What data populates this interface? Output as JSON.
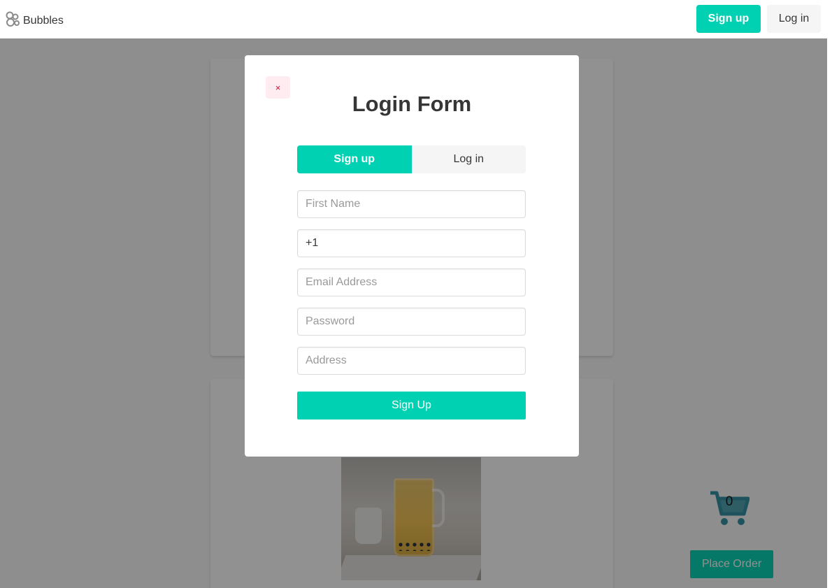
{
  "navbar": {
    "brand": "Bubbles",
    "brand_icon": "bubbles-logo-icon",
    "signup_label": "Sign up",
    "login_label": "Log in"
  },
  "page": {
    "cart_count": "0",
    "cart_icon": "shopping-cart-icon",
    "place_order_label": "Place Order"
  },
  "modal": {
    "close_label": "×",
    "title": "Login Form",
    "tabs": {
      "signup": "Sign up",
      "login": "Log in",
      "active": "signup"
    },
    "fields": {
      "first_name_placeholder": "First Name",
      "phone_value": "+1",
      "email_placeholder": "Email Address",
      "password_placeholder": "Password",
      "address_placeholder": "Address"
    },
    "submit_label": "Sign Up"
  },
  "colors": {
    "primary": "#00d1b2",
    "close_bg": "#feecf0",
    "close_fg": "#cc0f35",
    "cart": "#2f8fa3"
  }
}
